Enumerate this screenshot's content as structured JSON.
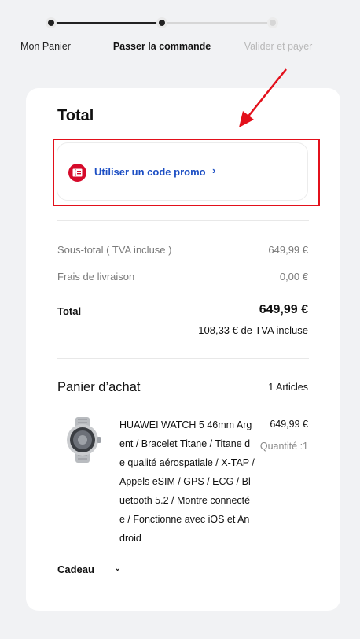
{
  "stepper": {
    "steps": [
      {
        "label": "Mon Panier",
        "state": "done"
      },
      {
        "label": "Passer la commande",
        "state": "current"
      },
      {
        "label": "Valider et payer",
        "state": "todo"
      }
    ]
  },
  "summary": {
    "title": "Total",
    "promo_label": "Utiliser un code promo",
    "promo_chevron": "›",
    "subtotal_label": "Sous-total ( TVA incluse )",
    "subtotal_value": "649,99 €",
    "shipping_label": "Frais de livraison",
    "shipping_value": "0,00 €",
    "total_label": "Total",
    "total_value": "649,99 €",
    "vat_note": "108,33 € de TVA incluse"
  },
  "cart": {
    "title": "Panier d’achat",
    "count": "1 Articles",
    "item": {
      "name": "HUAWEI WATCH 5 46mm Argent / Bracelet Titane / Titane de qualité aérospatiale / X-TAP / Appels eSIM / GPS / ECG / Bluetooth 5.2 / Montre connectée / Fonctionne avec iOS et Android",
      "price": "649,99 €",
      "quantity": "Quantité :1"
    },
    "gift_label": "Cadeau",
    "gift_chevron": "⌄"
  },
  "colors": {
    "accent_blue": "#1d4fc4",
    "promo_icon_red": "#d60a2a",
    "highlight_red": "#e3101b"
  },
  "icons": [
    "coupon-icon",
    "chevron-right-icon",
    "chevron-down-icon",
    "annotation-arrow"
  ]
}
